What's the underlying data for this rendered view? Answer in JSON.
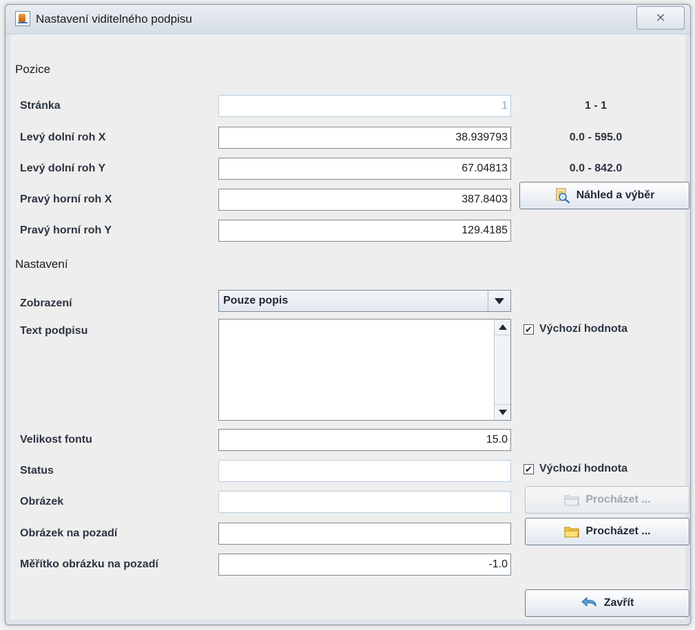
{
  "window": {
    "title": "Nastavení viditelného podpisu",
    "close_glyph": "⨯"
  },
  "sections": {
    "position": "Pozice",
    "settings": "Nastavení"
  },
  "position": {
    "page": {
      "label": "Stránka",
      "value": "1",
      "range": "1 - 1"
    },
    "lower_left_x": {
      "label": "Levý dolní roh X",
      "value": "38.939793",
      "range": "0.0 - 595.0"
    },
    "lower_left_y": {
      "label": "Levý dolní roh Y",
      "value": "67.04813",
      "range": "0.0 - 842.0"
    },
    "upper_right_x": {
      "label": "Pravý horní roh X",
      "value": "387.8403"
    },
    "upper_right_y": {
      "label": "Pravý horní roh Y",
      "value": "129.4185"
    },
    "preview_button": "Náhled a výběr"
  },
  "settings": {
    "display": {
      "label": "Zobrazení",
      "selected": "Pouze popis"
    },
    "signature_text": {
      "label": "Text podpisu",
      "value": "",
      "default_checkbox": "Výchozí hodnota",
      "default_checked": true
    },
    "font_size": {
      "label": "Velikost fontu",
      "value": "15.0"
    },
    "status": {
      "label": "Status",
      "value": "",
      "default_checkbox": "Výchozí hodnota",
      "default_checked": true
    },
    "image": {
      "label": "Obrázek",
      "value": "",
      "browse_button": "Procházet ..."
    },
    "background_image": {
      "label": "Obrázek na pozadí",
      "value": "",
      "browse_button": "Procházet ..."
    },
    "background_scale": {
      "label": "Měřítko obrázku na pozadí",
      "value": "-1.0"
    }
  },
  "footer": {
    "close_button": "Zavřít"
  },
  "icons": {
    "preview": "magnifier-document-icon",
    "browse": "folder-icon",
    "close": "undo-arrow-icon",
    "dropdown": "triangle-down-icon"
  }
}
